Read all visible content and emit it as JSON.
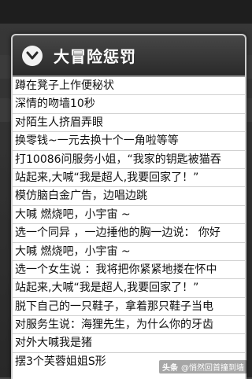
{
  "dialog": {
    "title": "大冒险惩罚",
    "icon": "chevron-down-circle-icon",
    "items": [
      "蹲在凳子上作便秘状",
      "深情的吻墙10秒",
      "对陌生人挤眉弄眼",
      "换零钱~一元去换十个一角啦等等",
      "打10086问服务小姐，“我家的钥匙被猫吞",
      "站起来,大喊“我是超人,我要回家了！”",
      "模仿脑白金广告，边唱边跳",
      "大喊 燃烧吧，小宇宙 ~",
      "选一个同异 ，一边捶他的胸一边说： 你好",
      "大喊 燃烧吧，小宇宙 ~",
      "选一个女生说 ：我将把你紧紧地搂在怀中",
      "站起来,大喊“我是超人,我要回家了！”",
      "脱下自己的一只鞋子，拿着那只鞋子当电",
      "对服务生说：海狸先生，为什么你的牙齿",
      "对外大喊我是猪",
      "摆3个芙蓉姐姐S形"
    ]
  },
  "watermark": {
    "brand": "头条",
    "text": "@悄然回首撞到墙"
  },
  "colors": {
    "header": "#333333",
    "divider": "#d0d0d0",
    "text": "#111111"
  }
}
